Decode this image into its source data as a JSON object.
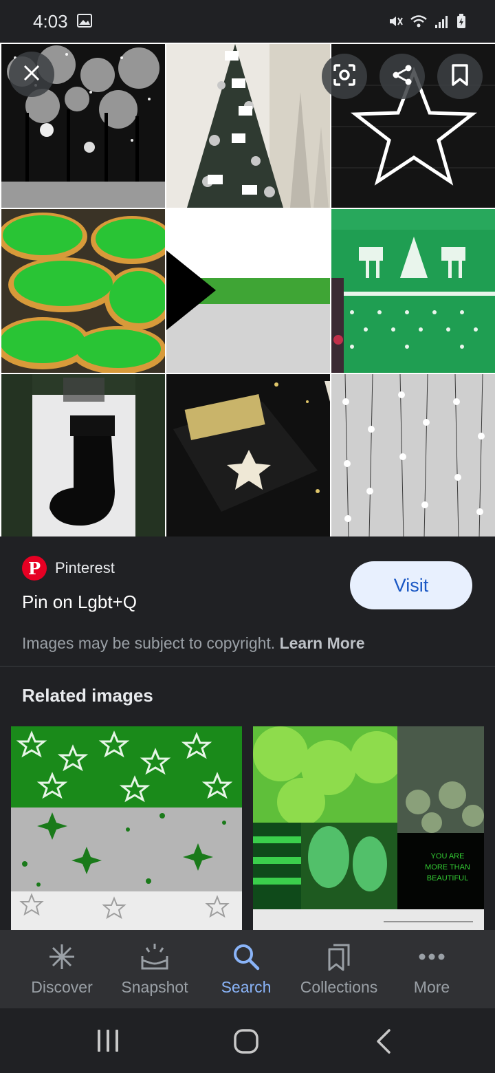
{
  "status": {
    "time": "4:03"
  },
  "source": {
    "name": "Pinterest",
    "title": "Pin on Lgbt+Q"
  },
  "actions": {
    "visit_label": "Visit"
  },
  "copyright": {
    "text": "Images may be subject to copyright.",
    "link": "Learn More"
  },
  "related": {
    "heading": "Related images",
    "second_image_text": [
      "YOU ARE",
      "MORE THAN",
      "BEAUTIFUL"
    ]
  },
  "nav": {
    "items": [
      {
        "label": "Discover",
        "icon": "asterisk-icon"
      },
      {
        "label": "Snapshot",
        "icon": "snapshot-icon"
      },
      {
        "label": "Search",
        "icon": "search-icon"
      },
      {
        "label": "Collections",
        "icon": "collections-icon"
      },
      {
        "label": "More",
        "icon": "more-dots-icon"
      }
    ],
    "active": "Search"
  },
  "colors": {
    "background": "#202124",
    "accent": "#8ab4f8",
    "visit_bg": "#e8f0fe",
    "visit_text": "#1a57c4",
    "pinterest": "#e60023",
    "flag_green": "#3fa535"
  }
}
